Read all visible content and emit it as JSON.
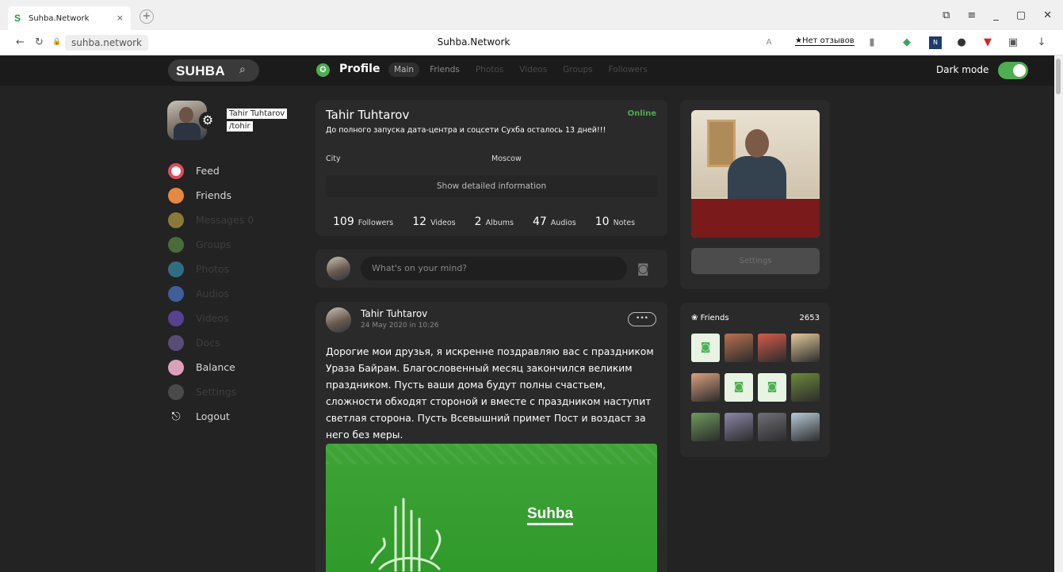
{
  "browser": {
    "tab_title": "Suhba.Network",
    "tab_favicon": "S",
    "tab_close": "×",
    "new_tab": "+",
    "url": "suhba.network",
    "page_title": "Suhba.Network",
    "reviews": "★Нет отзывов",
    "window_controls": [
      "⧉",
      "≡",
      "_",
      "▢",
      "✕"
    ],
    "nav": {
      "back": "←",
      "reload": "↻",
      "lock": "🔒"
    },
    "extensions": [
      "bookmark-icon",
      "shield-icon",
      "news-icon",
      "lightbulb-icon",
      "pin-icon",
      "puzzle-icon",
      "download-icon"
    ]
  },
  "header": {
    "logo": "SUHBA",
    "search_icon": "⌕",
    "profile_label": "Profile",
    "tabs": [
      {
        "label": "Main"
      },
      {
        "label": "Friends"
      },
      {
        "label": "Photos"
      },
      {
        "label": "Videos"
      },
      {
        "label": "Groups"
      },
      {
        "label": "Followers"
      }
    ],
    "dark_mode_label": "Dark mode",
    "dark_mode_on": true
  },
  "sidebar": {
    "user_name": "Tahir Tuhtarov",
    "user_handle": "/tohir",
    "items": [
      {
        "label": "Feed",
        "icon": "feed-icon",
        "color": "#f0f0f0",
        "active": true
      },
      {
        "label": "Friends",
        "icon": "friends-icon",
        "color": "#e7883f",
        "active": true
      },
      {
        "label": "Messages 0",
        "icon": "messages-icon",
        "color": "#8a7a3a",
        "active": false
      },
      {
        "label": "Groups",
        "icon": "groups-icon",
        "color": "#4b6b3b",
        "active": false
      },
      {
        "label": "Photos",
        "icon": "photos-icon",
        "color": "#2f6e82",
        "active": false
      },
      {
        "label": "Audios",
        "icon": "audios-icon",
        "color": "#3f5e9a",
        "active": false
      },
      {
        "label": "Videos",
        "icon": "videos-icon",
        "color": "#58418e",
        "active": false
      },
      {
        "label": "Docs",
        "icon": "docs-icon",
        "color": "#5a4c78",
        "active": false
      },
      {
        "label": "Balance",
        "icon": "balance-icon",
        "color": "#d9a2b8",
        "active": true
      },
      {
        "label": "Settings",
        "icon": "settings-icon",
        "color": "#4a4a4a",
        "active": false
      },
      {
        "label": "Logout",
        "icon": "logout-icon",
        "color": "#ffffff",
        "active": true
      }
    ]
  },
  "profile": {
    "name": "Tahir Tuhtarov",
    "status": "Online",
    "status_message": "До полного запуска дата-центра и соцсети Сухба осталось 13 дней!!!",
    "city_label": "City",
    "city_value": "Moscow",
    "detail_button": "Show detailed information",
    "stats": [
      {
        "num": "109",
        "label": "Followers"
      },
      {
        "num": "12",
        "label": "Videos"
      },
      {
        "num": "2",
        "label": "Albums"
      },
      {
        "num": "47",
        "label": "Audios"
      },
      {
        "num": "10",
        "label": "Notes"
      }
    ]
  },
  "composer": {
    "placeholder": "What's on your mind?"
  },
  "post": {
    "author": "Tahir Tuhtarov",
    "date": "24 May 2020 in 10:26",
    "more": "•••",
    "text": "Дорогие мои друзья, я искренне поздравляю вас  с праздником Ураза Байрам.  Благословенный месяц закончился великим праздником.  Пусть ваши дома будут полны счастьем, сложности обходят стороной и вместе с праздником наступит светлая сторона. Пусть Всевышний примет Пост и воздаст за него без меры.",
    "image_logo": "Suhba"
  },
  "photo_card": {
    "settings_button": "Settings"
  },
  "friends": {
    "title": "Friends",
    "count": "2653",
    "tiles": [
      {
        "kind": "placeholder"
      },
      {
        "kind": "photo",
        "color": "#b9714f"
      },
      {
        "kind": "photo",
        "color": "#d65a48"
      },
      {
        "kind": "photo",
        "color": "#e2c99b"
      },
      {
        "kind": "photo",
        "color": "#d9a07f"
      },
      {
        "kind": "placeholder"
      },
      {
        "kind": "placeholder"
      },
      {
        "kind": "photo",
        "color": "#6d8a3a"
      },
      {
        "kind": "photo",
        "color": "#6d9a5c"
      },
      {
        "kind": "photo",
        "color": "#8b86a8"
      },
      {
        "kind": "photo",
        "color": "#6f6f76"
      },
      {
        "kind": "photo",
        "color": "#b7cad8"
      }
    ]
  }
}
